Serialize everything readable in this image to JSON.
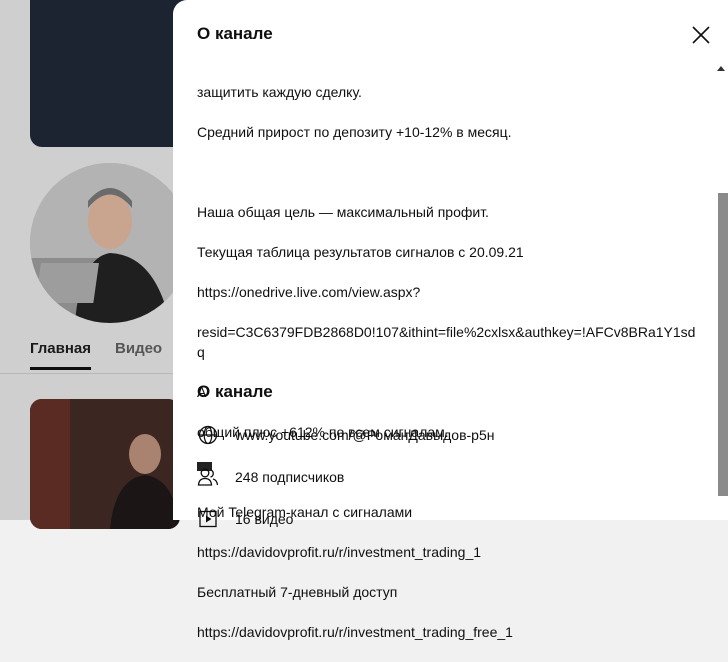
{
  "background": {
    "tabs": [
      {
        "label": "Главная"
      },
      {
        "label": "Видео"
      }
    ]
  },
  "panel": {
    "title": "О канале",
    "close_icon": "close-icon",
    "description_lines": [
      "защитить каждую сделку.",
      "Средний прирост по депозиту +10-12% в месяц.",
      "",
      "Наша общая цель — максимальный профит.",
      "Текущая таблица результатов сигналов с 20.09.21",
      "https://onedrive.live.com/view.aspx?",
      "resid=C3C6379FDB2868D0!107&ithint=file%2cxlsx&authkey=!AFCv8BRa1Y1sdq",
      "A",
      "общий плюс +612% по всем сигналам.",
      "",
      "Мой Telegram-канал с сигналами",
      "https://davidovprofit.ru/r/investment_trading_1",
      "Бесплатный 7-дневный доступ",
      "https://davidovprofit.ru/r/investment_trading_free_1"
    ],
    "about_title": "О канале",
    "channel_url": "www.youtube.com/@РоманДавыдов-р5н",
    "subscribers": "248 подписчиков",
    "videos": "16 видео"
  }
}
